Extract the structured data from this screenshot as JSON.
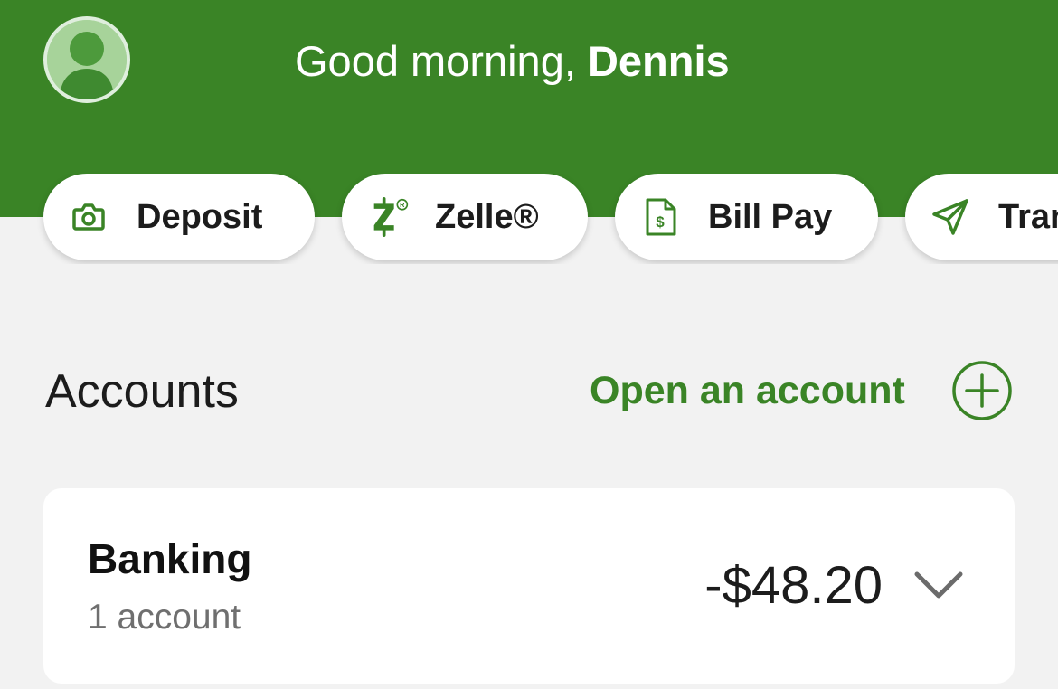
{
  "header": {
    "greeting_prefix": "Good morning, ",
    "user_name": "Dennis",
    "background_color": "#3a8426"
  },
  "quick_actions": [
    {
      "label": "Deposit",
      "icon": "camera-icon"
    },
    {
      "label": "Zelle®",
      "icon": "zelle-icon"
    },
    {
      "label": "Bill Pay",
      "icon": "bill-pay-icon"
    },
    {
      "label": "Transfer",
      "icon": "send-icon"
    }
  ],
  "accounts": {
    "title": "Accounts",
    "open_account_label": "Open an account",
    "open_account_icon": "plus-circle-icon",
    "accent_color": "#3a8426",
    "groups": [
      {
        "name": "Banking",
        "count_label": "1 account",
        "balance": "-$48.20",
        "expand_icon": "chevron-down-icon"
      }
    ]
  }
}
